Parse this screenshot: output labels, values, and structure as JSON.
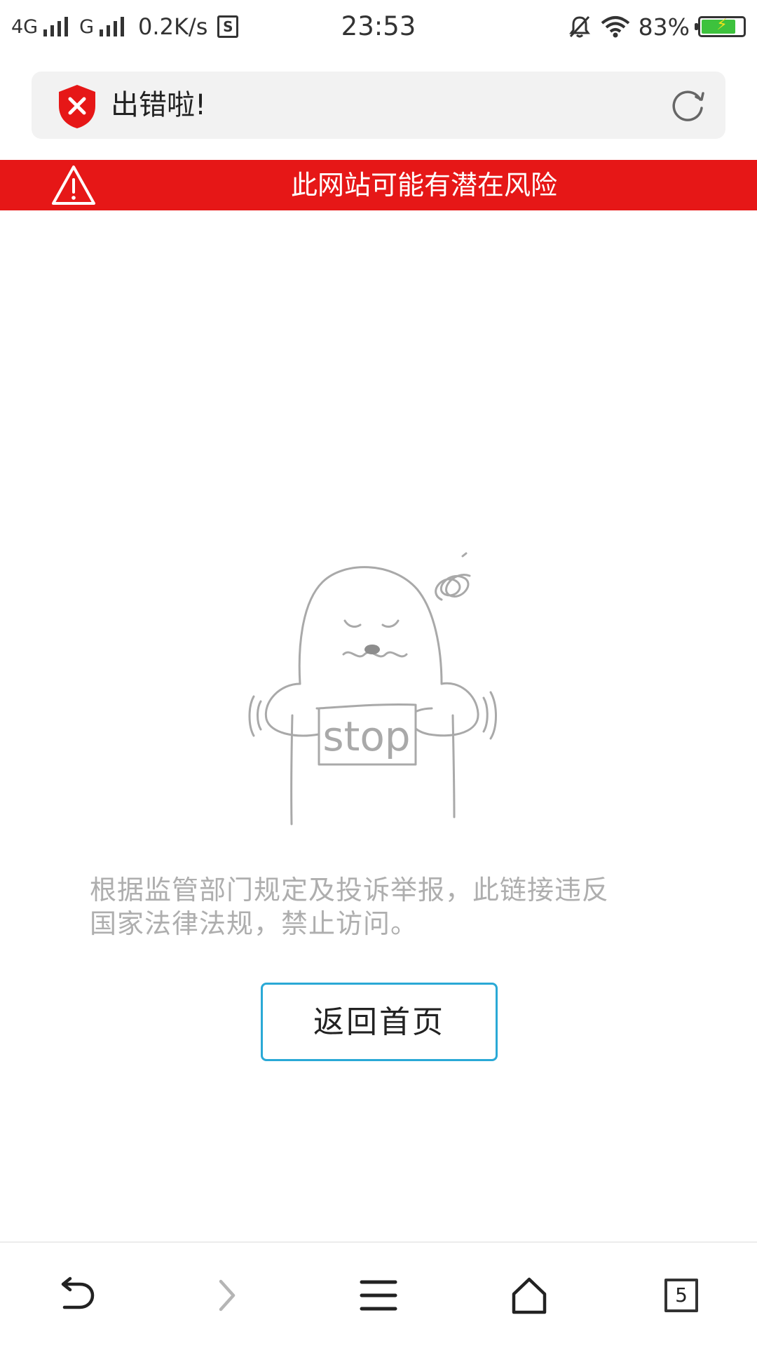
{
  "status_bar": {
    "net1": "4G",
    "net2": "G",
    "speed": "0.2K/s",
    "sim_glyph": "S",
    "time": "23:53",
    "battery": "83%",
    "battery_level": 0.83,
    "icons": [
      "signal-icon",
      "sim-icon",
      "mute-icon",
      "wifi-icon",
      "battery-icon"
    ]
  },
  "address_bar": {
    "title": "出错啦!",
    "icons": [
      "shield-error-icon",
      "reload-icon"
    ],
    "accent": "#e61717"
  },
  "warning_banner": {
    "text": "此网站可能有潜在风险",
    "color": "#e61717",
    "icon": "warning-triangle-icon"
  },
  "illustration": {
    "sign_text": "stop"
  },
  "message": {
    "line1": "根据监管部门规定及投诉举报，此链接违反",
    "line2": "国家法律法规，禁止访问。"
  },
  "home_button": {
    "label": "返回首页",
    "border_color": "#2aa9d6"
  },
  "bottom_nav": {
    "tab_count": "5",
    "icons": [
      "back-icon",
      "forward-icon",
      "menu-icon",
      "home-icon",
      "tabs-icon"
    ]
  }
}
